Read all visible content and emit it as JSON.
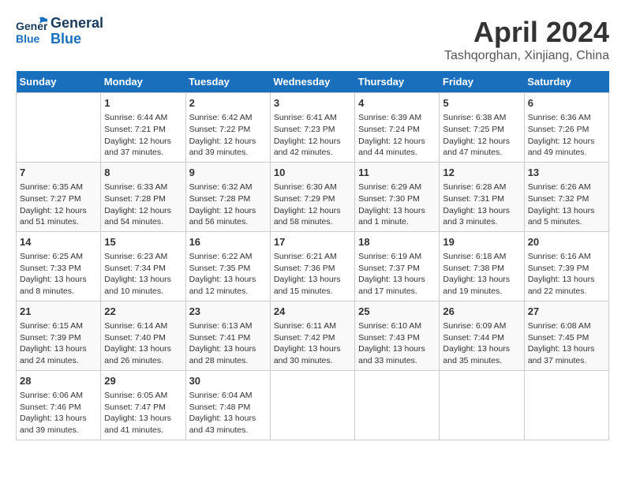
{
  "header": {
    "logo_line1": "General",
    "logo_line2": "Blue",
    "main_title": "April 2024",
    "subtitle": "Tashqorghan, Xinjiang, China"
  },
  "calendar": {
    "days_of_week": [
      "Sunday",
      "Monday",
      "Tuesday",
      "Wednesday",
      "Thursday",
      "Friday",
      "Saturday"
    ],
    "weeks": [
      [
        {
          "day": "",
          "info": ""
        },
        {
          "day": "1",
          "info": "Sunrise: 6:44 AM\nSunset: 7:21 PM\nDaylight: 12 hours\nand 37 minutes."
        },
        {
          "day": "2",
          "info": "Sunrise: 6:42 AM\nSunset: 7:22 PM\nDaylight: 12 hours\nand 39 minutes."
        },
        {
          "day": "3",
          "info": "Sunrise: 6:41 AM\nSunset: 7:23 PM\nDaylight: 12 hours\nand 42 minutes."
        },
        {
          "day": "4",
          "info": "Sunrise: 6:39 AM\nSunset: 7:24 PM\nDaylight: 12 hours\nand 44 minutes."
        },
        {
          "day": "5",
          "info": "Sunrise: 6:38 AM\nSunset: 7:25 PM\nDaylight: 12 hours\nand 47 minutes."
        },
        {
          "day": "6",
          "info": "Sunrise: 6:36 AM\nSunset: 7:26 PM\nDaylight: 12 hours\nand 49 minutes."
        }
      ],
      [
        {
          "day": "7",
          "info": "Sunrise: 6:35 AM\nSunset: 7:27 PM\nDaylight: 12 hours\nand 51 minutes."
        },
        {
          "day": "8",
          "info": "Sunrise: 6:33 AM\nSunset: 7:28 PM\nDaylight: 12 hours\nand 54 minutes."
        },
        {
          "day": "9",
          "info": "Sunrise: 6:32 AM\nSunset: 7:28 PM\nDaylight: 12 hours\nand 56 minutes."
        },
        {
          "day": "10",
          "info": "Sunrise: 6:30 AM\nSunset: 7:29 PM\nDaylight: 12 hours\nand 58 minutes."
        },
        {
          "day": "11",
          "info": "Sunrise: 6:29 AM\nSunset: 7:30 PM\nDaylight: 13 hours\nand 1 minute."
        },
        {
          "day": "12",
          "info": "Sunrise: 6:28 AM\nSunset: 7:31 PM\nDaylight: 13 hours\nand 3 minutes."
        },
        {
          "day": "13",
          "info": "Sunrise: 6:26 AM\nSunset: 7:32 PM\nDaylight: 13 hours\nand 5 minutes."
        }
      ],
      [
        {
          "day": "14",
          "info": "Sunrise: 6:25 AM\nSunset: 7:33 PM\nDaylight: 13 hours\nand 8 minutes."
        },
        {
          "day": "15",
          "info": "Sunrise: 6:23 AM\nSunset: 7:34 PM\nDaylight: 13 hours\nand 10 minutes."
        },
        {
          "day": "16",
          "info": "Sunrise: 6:22 AM\nSunset: 7:35 PM\nDaylight: 13 hours\nand 12 minutes."
        },
        {
          "day": "17",
          "info": "Sunrise: 6:21 AM\nSunset: 7:36 PM\nDaylight: 13 hours\nand 15 minutes."
        },
        {
          "day": "18",
          "info": "Sunrise: 6:19 AM\nSunset: 7:37 PM\nDaylight: 13 hours\nand 17 minutes."
        },
        {
          "day": "19",
          "info": "Sunrise: 6:18 AM\nSunset: 7:38 PM\nDaylight: 13 hours\nand 19 minutes."
        },
        {
          "day": "20",
          "info": "Sunrise: 6:16 AM\nSunset: 7:39 PM\nDaylight: 13 hours\nand 22 minutes."
        }
      ],
      [
        {
          "day": "21",
          "info": "Sunrise: 6:15 AM\nSunset: 7:39 PM\nDaylight: 13 hours\nand 24 minutes."
        },
        {
          "day": "22",
          "info": "Sunrise: 6:14 AM\nSunset: 7:40 PM\nDaylight: 13 hours\nand 26 minutes."
        },
        {
          "day": "23",
          "info": "Sunrise: 6:13 AM\nSunset: 7:41 PM\nDaylight: 13 hours\nand 28 minutes."
        },
        {
          "day": "24",
          "info": "Sunrise: 6:11 AM\nSunset: 7:42 PM\nDaylight: 13 hours\nand 30 minutes."
        },
        {
          "day": "25",
          "info": "Sunrise: 6:10 AM\nSunset: 7:43 PM\nDaylight: 13 hours\nand 33 minutes."
        },
        {
          "day": "26",
          "info": "Sunrise: 6:09 AM\nSunset: 7:44 PM\nDaylight: 13 hours\nand 35 minutes."
        },
        {
          "day": "27",
          "info": "Sunrise: 6:08 AM\nSunset: 7:45 PM\nDaylight: 13 hours\nand 37 minutes."
        }
      ],
      [
        {
          "day": "28",
          "info": "Sunrise: 6:06 AM\nSunset: 7:46 PM\nDaylight: 13 hours\nand 39 minutes."
        },
        {
          "day": "29",
          "info": "Sunrise: 6:05 AM\nSunset: 7:47 PM\nDaylight: 13 hours\nand 41 minutes."
        },
        {
          "day": "30",
          "info": "Sunrise: 6:04 AM\nSunset: 7:48 PM\nDaylight: 13 hours\nand 43 minutes."
        },
        {
          "day": "",
          "info": ""
        },
        {
          "day": "",
          "info": ""
        },
        {
          "day": "",
          "info": ""
        },
        {
          "day": "",
          "info": ""
        }
      ]
    ]
  }
}
